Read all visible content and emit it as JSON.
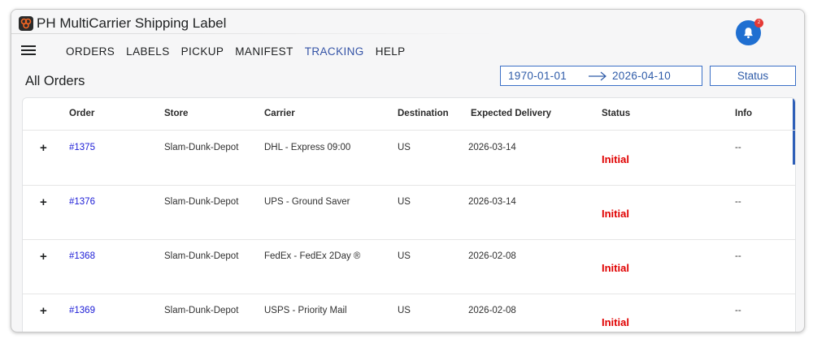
{
  "app": {
    "title": "PH MultiCarrier Shipping Label",
    "notification_count": "2"
  },
  "nav": {
    "items": [
      {
        "label": "ORDERS",
        "active": false
      },
      {
        "label": "LABELS",
        "active": false
      },
      {
        "label": "PICKUP",
        "active": false
      },
      {
        "label": "MANIFEST",
        "active": false
      },
      {
        "label": "TRACKING",
        "active": true
      },
      {
        "label": "HELP",
        "active": false
      }
    ]
  },
  "page": {
    "title": "All Orders"
  },
  "filters": {
    "date_start": "1970-01-01",
    "date_end": "2026-04-10",
    "status_label": "Status"
  },
  "table": {
    "headers": [
      "Order",
      "Store",
      "Carrier",
      "Destination",
      "Expected Delivery",
      "Status",
      "Info"
    ],
    "expand_symbol": "+",
    "rows": [
      {
        "order": "#1375",
        "store": "Slam-Dunk-Depot",
        "carrier": "DHL - Express 09:00",
        "destination": "US",
        "expected": "2026-03-14",
        "status": "Initial",
        "info": "--"
      },
      {
        "order": "#1376",
        "store": "Slam-Dunk-Depot",
        "carrier": "UPS - Ground Saver",
        "destination": "US",
        "expected": "2026-03-14",
        "status": "Initial",
        "info": "--"
      },
      {
        "order": "#1368",
        "store": "Slam-Dunk-Depot",
        "carrier": "FedEx - FedEx 2Day ®",
        "destination": "US",
        "expected": "2026-02-08",
        "status": "Initial",
        "info": "--"
      },
      {
        "order": "#1369",
        "store": "Slam-Dunk-Depot",
        "carrier": "USPS - Priority Mail",
        "destination": "US",
        "expected": "2026-02-08",
        "status": "Initial",
        "info": "--"
      }
    ]
  },
  "colors": {
    "accent": "#3453a6",
    "link": "#1a1ad6",
    "status_initial": "#e00000",
    "bell": "#1f6fd1"
  }
}
